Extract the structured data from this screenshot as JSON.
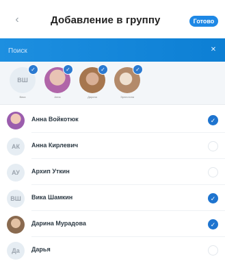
{
  "header": {
    "back_icon": "chevron-left-icon",
    "title": "Добавление в группу",
    "done_label": "Готово"
  },
  "search": {
    "placeholder": "Поиск",
    "clear_icon": "clear-icon"
  },
  "selected": [
    {
      "initials": "ВШ",
      "name": "Вика",
      "photo": false
    },
    {
      "initials": "",
      "name": "Анна",
      "photo": true,
      "color": "#b065a8"
    },
    {
      "initials": "",
      "name": "Дарина",
      "photo": true,
      "color": "#a6764e"
    },
    {
      "initials": "",
      "name": "Эрнестина",
      "photo": true,
      "color": "#b38a6a"
    }
  ],
  "contacts": [
    {
      "name": "Анна Войкотюк",
      "initials": "",
      "photo": true,
      "color": "#9b5dad",
      "selected": true
    },
    {
      "name": "Анна Кирлевич",
      "initials": "АК",
      "photo": false,
      "selected": false
    },
    {
      "name": "Архип Уткин",
      "initials": "АУ",
      "photo": false,
      "selected": false
    },
    {
      "name": "Вика Шамкин",
      "initials": "ВШ",
      "photo": false,
      "selected": true
    },
    {
      "name": "Дарина Мурадова",
      "initials": "",
      "photo": true,
      "color": "#8a6a4f",
      "selected": true
    },
    {
      "name": "Дарья",
      "initials": "Да",
      "photo": false,
      "selected": false
    }
  ],
  "colors": {
    "accent": "#1e88e5",
    "search_bar": "#1d8fe0",
    "check": "#1e74cf"
  }
}
